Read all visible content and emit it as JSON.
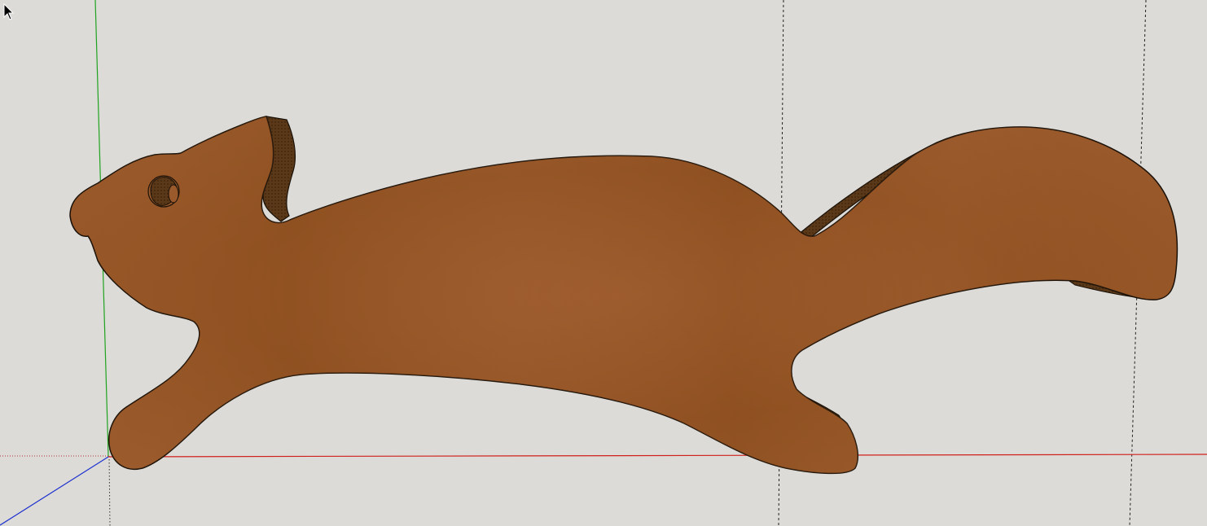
{
  "viewport": {
    "background": "#dcdbd7"
  },
  "axes": {
    "x_axis_color": "#d0201c",
    "y_axis_color": "#1fa31f",
    "z_axis_color": "#1b2fcf",
    "guide_color": "#202020"
  },
  "model": {
    "name": "squirrel-cutout",
    "face_color": "#9a5a2c",
    "edge_color": "#1a1108",
    "side_color": "#5a3818",
    "eye_icon": "eye-hole-icon"
  },
  "cursor": {
    "icon": "arrow-cursor-icon"
  }
}
